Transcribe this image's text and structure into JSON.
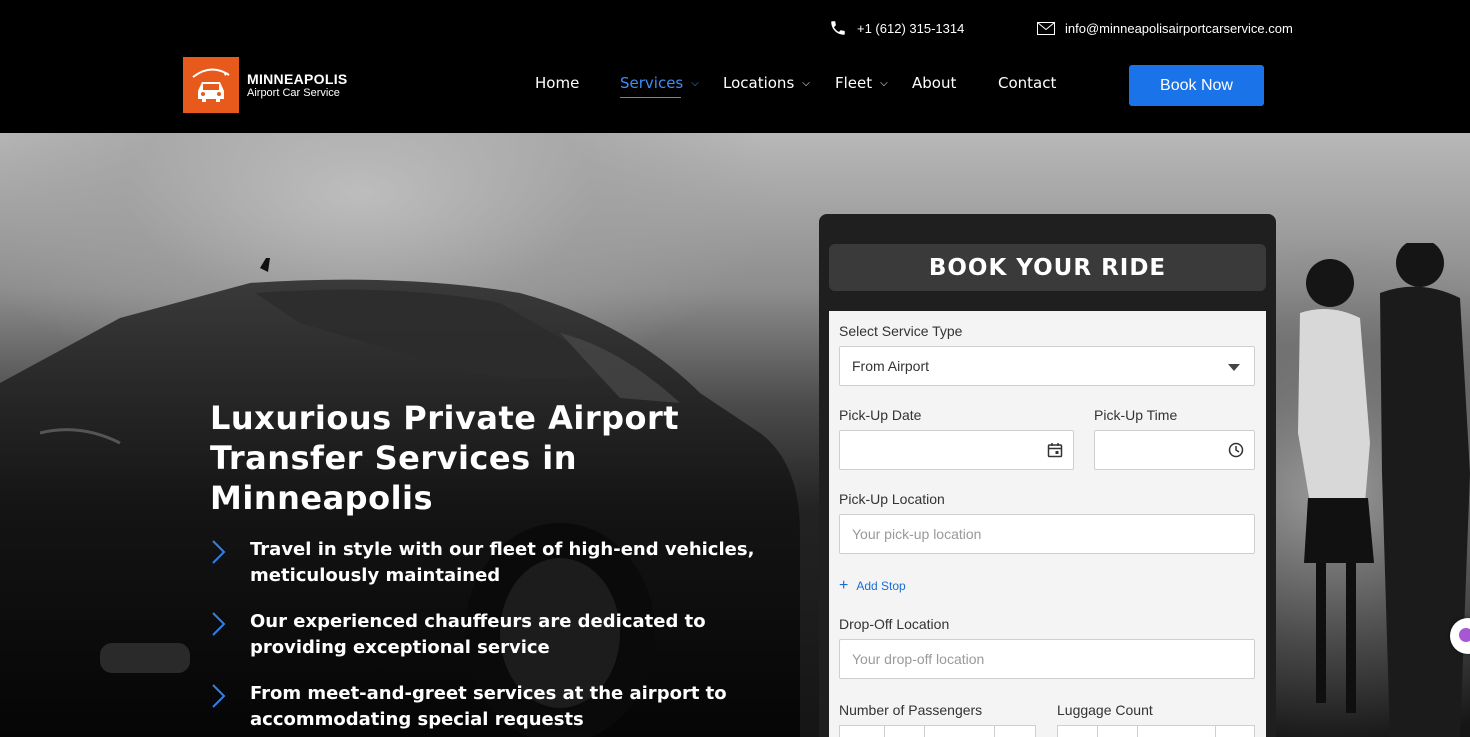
{
  "header": {
    "phone": "+1 (612) 315-1314",
    "email": "info@minneapolisairportcarservice.com",
    "logo": {
      "title": "MINNEAPOLIS",
      "subtitle": "Airport Car Service",
      "icon": "car-icon"
    },
    "nav": [
      {
        "label": "Home",
        "has_dropdown": false
      },
      {
        "label": "Services",
        "has_dropdown": true,
        "active": true
      },
      {
        "label": "Locations",
        "has_dropdown": true
      },
      {
        "label": "Fleet",
        "has_dropdown": true
      },
      {
        "label": "About",
        "has_dropdown": false
      },
      {
        "label": "Contact",
        "has_dropdown": false
      }
    ],
    "book_button": "Book Now"
  },
  "hero": {
    "title": "Luxurious Private Airport Transfer Services in Minneapolis",
    "bullets": [
      "Travel in style with our fleet of high-end vehicles, meticulously maintained",
      "Our experienced chauffeurs are dedicated to providing exceptional service",
      "From meet-and-greet services at the airport to accommodating special requests"
    ]
  },
  "booking": {
    "title": "BOOK YOUR RIDE",
    "service_type_label": "Select Service Type",
    "service_type_value": "From Airport",
    "pickup_date_label": "Pick-Up Date",
    "pickup_time_label": "Pick-Up Time",
    "pickup_location_label": "Pick-Up Location",
    "pickup_location_placeholder": "Your pick-up location",
    "add_stop": "Add Stop",
    "dropoff_location_label": "Drop-Off Location",
    "dropoff_location_placeholder": "Your drop-off location",
    "passengers_label": "Number of Passengers",
    "luggage_label": "Luggage Count"
  },
  "colors": {
    "accent": "#1a73e8",
    "nav_active": "#3d8ef7",
    "logo_bg": "#e85a1b"
  }
}
